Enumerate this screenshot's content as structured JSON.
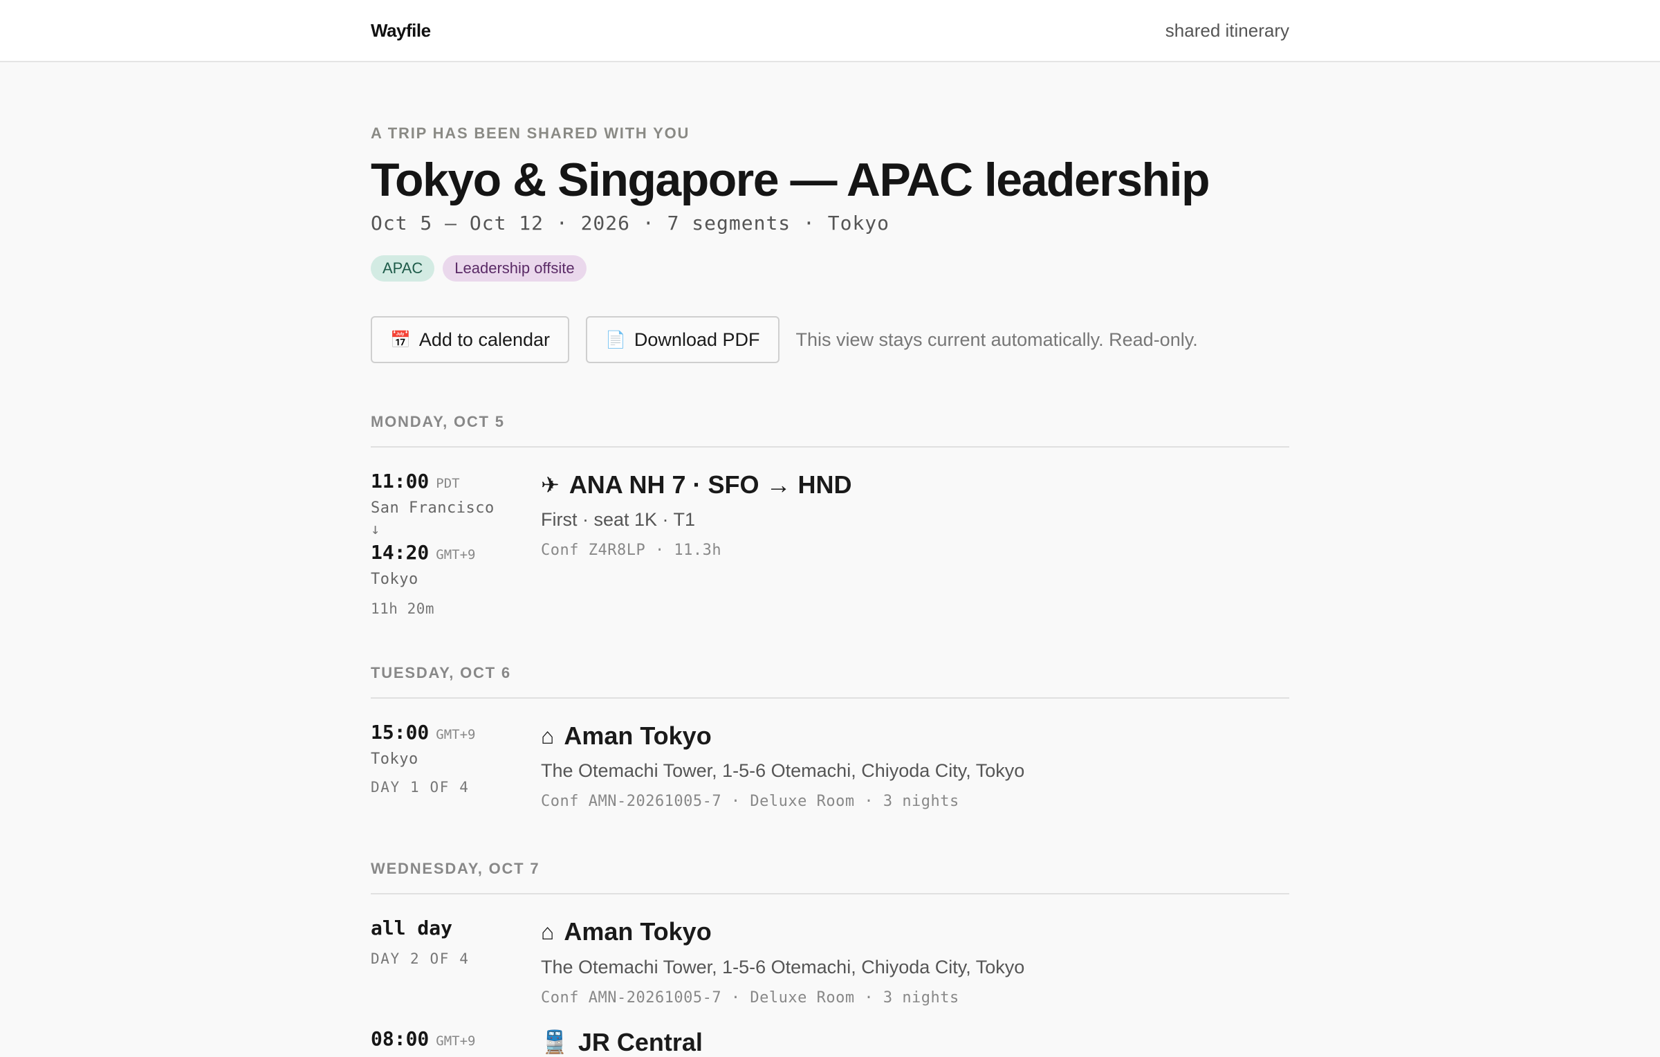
{
  "header": {
    "brand": "Wayfile",
    "right_label": "shared itinerary"
  },
  "trip": {
    "eyebrow": "A TRIP HAS BEEN SHARED WITH YOU",
    "title": "Tokyo & Singapore — APAC leadership",
    "subtitle": "Oct 5 – Oct 12 · 2026 · 7 segments · Tokyo",
    "tags": [
      {
        "label": "APAC",
        "bg": "#d3ebe3",
        "fg": "#1f5c4a"
      },
      {
        "label": "Leadership offsite",
        "bg": "#ead8ec",
        "fg": "#5a2a66"
      }
    ]
  },
  "actions": {
    "calendar_icon": "calendar-icon",
    "calendar_label": "Add to calendar",
    "pdf_icon": "document-icon",
    "pdf_label": "Download PDF",
    "note": "This view stays current automatically. Read-only."
  },
  "days": [
    {
      "heading": "MONDAY, OCT 5",
      "segment": {
        "icon": "airplane-icon",
        "depart_time": "11:00",
        "depart_zone": "PDT",
        "depart_place": "San Francisco",
        "arrow": "↓",
        "arrive_time": "14:20",
        "arrive_zone": "GMT+9",
        "arrive_place": "Tokyo",
        "duration": "11h 20m",
        "title": "ANA NH 7 · SFO → HND",
        "subtitle": "First · seat 1K · T1",
        "conf": "Conf Z4R8LP · 11.3h"
      }
    },
    {
      "heading": "TUESDAY, OCT 6",
      "segment": {
        "icon": "hotel-icon",
        "time": "15:00",
        "zone": "GMT+9",
        "place": "Tokyo",
        "meta": "DAY 1 OF 4",
        "title": "Aman Tokyo",
        "subtitle": "The Otemachi Tower, 1-5-6 Otemachi, Chiyoda City, Tokyo",
        "conf": "Conf AMN-20261005-7 · Deluxe Room · 3 nights"
      }
    },
    {
      "heading": "WEDNESDAY, OCT 7",
      "segment": {
        "icon": "hotel-icon",
        "time": "all day",
        "meta": "DAY 2 OF 4",
        "title": "Aman Tokyo",
        "subtitle": "The Otemachi Tower, 1-5-6 Otemachi, Chiyoda City, Tokyo",
        "conf": "Conf AMN-20261005-7 · Deluxe Room · 3 nights"
      },
      "segment2": {
        "icon": "train-icon",
        "time": "08:00",
        "zone": "GMT+9",
        "title": "JR Central"
      }
    }
  ]
}
